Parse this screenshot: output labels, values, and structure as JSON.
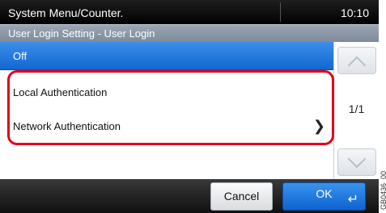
{
  "status": {
    "title": "System Menu/Counter.",
    "time": "10:10"
  },
  "header": {
    "title": "User Login Setting - User Login"
  },
  "list": {
    "items": [
      {
        "label": "Off",
        "selected": true
      },
      {
        "label": "Local Authentication"
      },
      {
        "label": "Network Authentication",
        "has_chevron": true
      },
      {
        "label": ""
      }
    ]
  },
  "pagination": {
    "page": "1/1"
  },
  "footer": {
    "cancel_label": "Cancel",
    "ok_label": "OK"
  },
  "figure_code": "GB0436_00",
  "colors": {
    "selected_row": "#1268d0",
    "highlight_border": "#e2001a",
    "ok_button": "#0d63cf"
  }
}
